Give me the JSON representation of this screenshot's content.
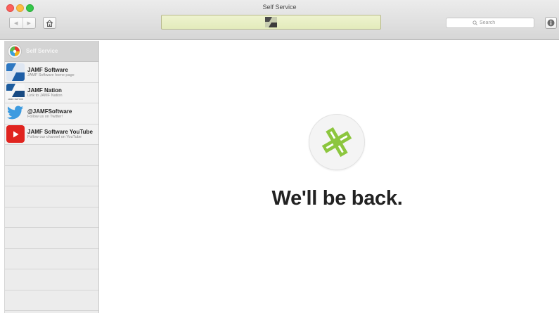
{
  "window": {
    "title": "Self Service"
  },
  "toolbar": {
    "back_glyph": "◀",
    "forward_glyph": "▶",
    "search_placeholder": "Search"
  },
  "sidebar": {
    "header_label": "Self Service",
    "items": [
      {
        "title": "JAMF Software",
        "subtitle": "JAMF Software home page",
        "icon": "jamf-software-icon"
      },
      {
        "title": "JAMF Nation",
        "subtitle": "Link to JAMF Nation",
        "icon": "jamf-nation-icon",
        "icon_caption": "JAMF NATION"
      },
      {
        "title": "@JAMFSoftware",
        "subtitle": "Follow us on Twitter!",
        "icon": "twitter-bird-icon"
      },
      {
        "title": "JAMF Software YouTube",
        "subtitle": "Follow our channel on YouTube",
        "icon": "youtube-play-icon"
      }
    ],
    "empty_rows": 8
  },
  "main": {
    "headline": "We'll be back."
  },
  "colors": {
    "accent_green": "#8cc63e",
    "center_display_bg": "#e6edc2",
    "youtube_red": "#e0241f",
    "twitter_blue": "#3d9be0"
  }
}
